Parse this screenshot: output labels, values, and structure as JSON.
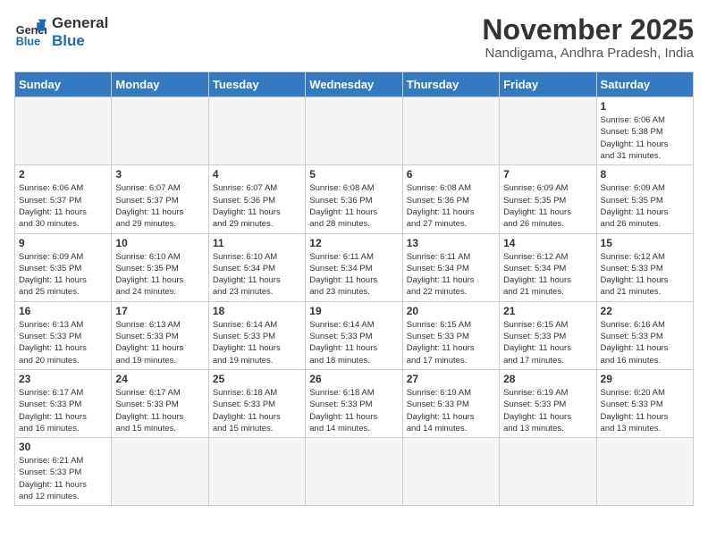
{
  "logo": {
    "text_general": "General",
    "text_blue": "Blue"
  },
  "title": "November 2025",
  "location": "Nandigama, Andhra Pradesh, India",
  "weekdays": [
    "Sunday",
    "Monday",
    "Tuesday",
    "Wednesday",
    "Thursday",
    "Friday",
    "Saturday"
  ],
  "days": [
    {
      "date": "",
      "info": ""
    },
    {
      "date": "",
      "info": ""
    },
    {
      "date": "",
      "info": ""
    },
    {
      "date": "",
      "info": ""
    },
    {
      "date": "",
      "info": ""
    },
    {
      "date": "",
      "info": ""
    },
    {
      "date": "1",
      "info": "Sunrise: 6:06 AM\nSunset: 5:38 PM\nDaylight: 11 hours\nand 31 minutes."
    },
    {
      "date": "2",
      "info": "Sunrise: 6:06 AM\nSunset: 5:37 PM\nDaylight: 11 hours\nand 30 minutes."
    },
    {
      "date": "3",
      "info": "Sunrise: 6:07 AM\nSunset: 5:37 PM\nDaylight: 11 hours\nand 29 minutes."
    },
    {
      "date": "4",
      "info": "Sunrise: 6:07 AM\nSunset: 5:36 PM\nDaylight: 11 hours\nand 29 minutes."
    },
    {
      "date": "5",
      "info": "Sunrise: 6:08 AM\nSunset: 5:36 PM\nDaylight: 11 hours\nand 28 minutes."
    },
    {
      "date": "6",
      "info": "Sunrise: 6:08 AM\nSunset: 5:36 PM\nDaylight: 11 hours\nand 27 minutes."
    },
    {
      "date": "7",
      "info": "Sunrise: 6:09 AM\nSunset: 5:35 PM\nDaylight: 11 hours\nand 26 minutes."
    },
    {
      "date": "8",
      "info": "Sunrise: 6:09 AM\nSunset: 5:35 PM\nDaylight: 11 hours\nand 26 minutes."
    },
    {
      "date": "9",
      "info": "Sunrise: 6:09 AM\nSunset: 5:35 PM\nDaylight: 11 hours\nand 25 minutes."
    },
    {
      "date": "10",
      "info": "Sunrise: 6:10 AM\nSunset: 5:35 PM\nDaylight: 11 hours\nand 24 minutes."
    },
    {
      "date": "11",
      "info": "Sunrise: 6:10 AM\nSunset: 5:34 PM\nDaylight: 11 hours\nand 23 minutes."
    },
    {
      "date": "12",
      "info": "Sunrise: 6:11 AM\nSunset: 5:34 PM\nDaylight: 11 hours\nand 23 minutes."
    },
    {
      "date": "13",
      "info": "Sunrise: 6:11 AM\nSunset: 5:34 PM\nDaylight: 11 hours\nand 22 minutes."
    },
    {
      "date": "14",
      "info": "Sunrise: 6:12 AM\nSunset: 5:34 PM\nDaylight: 11 hours\nand 21 minutes."
    },
    {
      "date": "15",
      "info": "Sunrise: 6:12 AM\nSunset: 5:33 PM\nDaylight: 11 hours\nand 21 minutes."
    },
    {
      "date": "16",
      "info": "Sunrise: 6:13 AM\nSunset: 5:33 PM\nDaylight: 11 hours\nand 20 minutes."
    },
    {
      "date": "17",
      "info": "Sunrise: 6:13 AM\nSunset: 5:33 PM\nDaylight: 11 hours\nand 19 minutes."
    },
    {
      "date": "18",
      "info": "Sunrise: 6:14 AM\nSunset: 5:33 PM\nDaylight: 11 hours\nand 19 minutes."
    },
    {
      "date": "19",
      "info": "Sunrise: 6:14 AM\nSunset: 5:33 PM\nDaylight: 11 hours\nand 18 minutes."
    },
    {
      "date": "20",
      "info": "Sunrise: 6:15 AM\nSunset: 5:33 PM\nDaylight: 11 hours\nand 17 minutes."
    },
    {
      "date": "21",
      "info": "Sunrise: 6:15 AM\nSunset: 5:33 PM\nDaylight: 11 hours\nand 17 minutes."
    },
    {
      "date": "22",
      "info": "Sunrise: 6:16 AM\nSunset: 5:33 PM\nDaylight: 11 hours\nand 16 minutes."
    },
    {
      "date": "23",
      "info": "Sunrise: 6:17 AM\nSunset: 5:33 PM\nDaylight: 11 hours\nand 16 minutes."
    },
    {
      "date": "24",
      "info": "Sunrise: 6:17 AM\nSunset: 5:33 PM\nDaylight: 11 hours\nand 15 minutes."
    },
    {
      "date": "25",
      "info": "Sunrise: 6:18 AM\nSunset: 5:33 PM\nDaylight: 11 hours\nand 15 minutes."
    },
    {
      "date": "26",
      "info": "Sunrise: 6:18 AM\nSunset: 5:33 PM\nDaylight: 11 hours\nand 14 minutes."
    },
    {
      "date": "27",
      "info": "Sunrise: 6:19 AM\nSunset: 5:33 PM\nDaylight: 11 hours\nand 14 minutes."
    },
    {
      "date": "28",
      "info": "Sunrise: 6:19 AM\nSunset: 5:33 PM\nDaylight: 11 hours\nand 13 minutes."
    },
    {
      "date": "29",
      "info": "Sunrise: 6:20 AM\nSunset: 5:33 PM\nDaylight: 11 hours\nand 13 minutes."
    },
    {
      "date": "30",
      "info": "Sunrise: 6:21 AM\nSunset: 5:33 PM\nDaylight: 11 hours\nand 12 minutes."
    },
    {
      "date": "",
      "info": ""
    },
    {
      "date": "",
      "info": ""
    },
    {
      "date": "",
      "info": ""
    },
    {
      "date": "",
      "info": ""
    },
    {
      "date": "",
      "info": ""
    },
    {
      "date": "",
      "info": ""
    }
  ]
}
